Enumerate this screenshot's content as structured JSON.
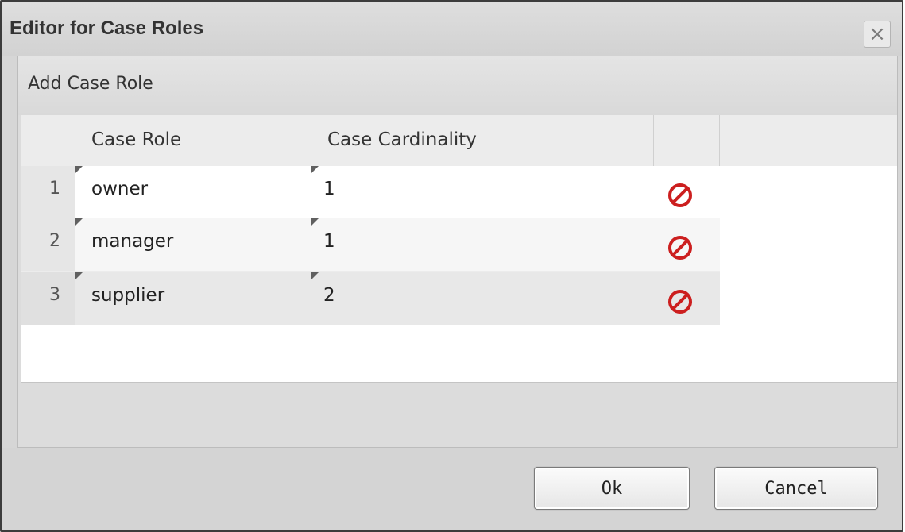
{
  "dialog": {
    "title": "Editor for Case Roles"
  },
  "toolbar": {
    "add_label": "Add Case Role"
  },
  "table": {
    "columns": [
      "Case Role",
      "Case Cardinality"
    ],
    "rows": [
      {
        "index": "1",
        "role": "owner",
        "cardinality": "1"
      },
      {
        "index": "2",
        "role": "manager",
        "cardinality": "1"
      },
      {
        "index": "3",
        "role": "supplier",
        "cardinality": "2"
      }
    ],
    "delete_icon": "delete-icon",
    "delete_color": "#cc1f1f"
  },
  "buttons": {
    "ok": "Ok",
    "cancel": "Cancel"
  },
  "icons": {
    "close": "close-icon"
  }
}
